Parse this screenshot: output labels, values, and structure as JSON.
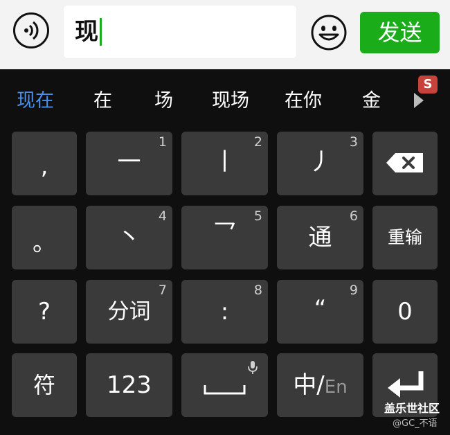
{
  "chat_input": {
    "text": "现",
    "send_label": "发送"
  },
  "candidates": [
    "现在",
    "在",
    "场",
    "现场",
    "在你",
    "金"
  ],
  "logo": {
    "letter": "S"
  },
  "keys": {
    "comma": ",",
    "one": {
      "glyph": "一",
      "num": "1"
    },
    "two": {
      "glyph": "丨",
      "num": "2"
    },
    "three": {
      "glyph": "丿",
      "num": "3"
    },
    "period": "。",
    "four": {
      "glyph": "丶",
      "num": "4"
    },
    "five": {
      "glyph": "乛",
      "num": "5"
    },
    "six": {
      "glyph": "通",
      "num": "6"
    },
    "reinput": "重输",
    "question": "?",
    "seven": {
      "glyph": "分词",
      "num": "7"
    },
    "eight": {
      "glyph": ":",
      "num": "8"
    },
    "nine": {
      "glyph": "“",
      "num": "9"
    },
    "zero": "0",
    "symbols": "符",
    "numeric": "123",
    "lang_zh": "中/",
    "lang_en": "En"
  },
  "watermark": {
    "line1": "盖乐世社区",
    "line2": "@GC_不语"
  },
  "colors": {
    "accent_green": "#1aad19",
    "selected_candidate": "#4a8fe7",
    "key_bg": "#3a3a3a",
    "keyboard_bg": "#0f0f0f"
  },
  "icons": [
    "voice-icon",
    "emoji-icon",
    "backspace-icon",
    "microphone-icon",
    "space-icon",
    "enter-icon",
    "more-candidates-icon",
    "sogou-logo-icon"
  ]
}
